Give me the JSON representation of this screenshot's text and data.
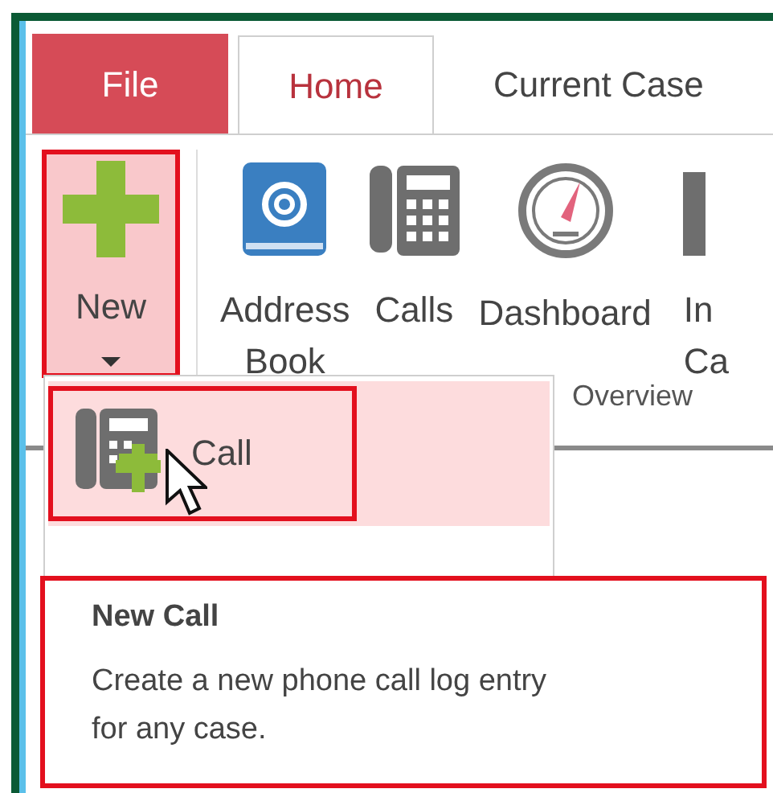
{
  "tabs": [
    {
      "label": "File",
      "kind": "file",
      "selected": false
    },
    {
      "label": "Home",
      "kind": "tab",
      "selected": true
    },
    {
      "label": "Current Case",
      "kind": "tab",
      "selected": false
    }
  ],
  "ribbon": {
    "new_button": {
      "label": "New",
      "highlighted": true
    },
    "buttons": [
      {
        "kind": "address-book",
        "lines": [
          "Address",
          "Book"
        ]
      },
      {
        "kind": "phone",
        "lines": [
          "Calls"
        ]
      },
      {
        "kind": "gauge",
        "lines": [
          "Dashboard"
        ]
      },
      {
        "kind": "cut",
        "lines": [
          "In",
          "Ca"
        ]
      }
    ],
    "group_label": "Overview"
  },
  "menu": {
    "items": [
      {
        "label": "Call",
        "selected": true,
        "highlighted": true
      }
    ]
  },
  "tooltip": {
    "title": "New Call",
    "text": "Create a new phone call log entry for any case.",
    "highlighted": true
  }
}
